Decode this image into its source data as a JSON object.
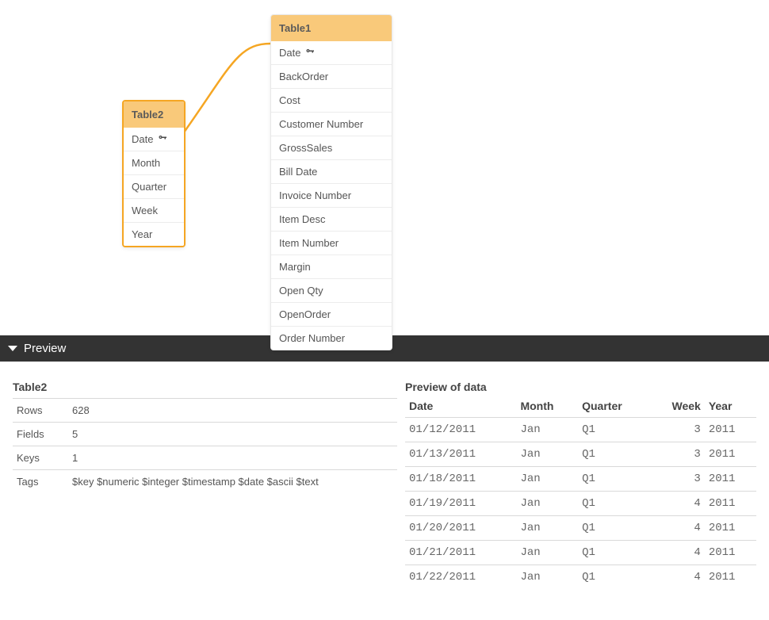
{
  "diagram": {
    "table1": {
      "title": "Table1",
      "fields": [
        {
          "name": "Date",
          "isKey": true
        },
        {
          "name": "BackOrder",
          "isKey": false
        },
        {
          "name": "Cost",
          "isKey": false
        },
        {
          "name": "Customer Number",
          "isKey": false
        },
        {
          "name": "GrossSales",
          "isKey": false
        },
        {
          "name": "Bill Date",
          "isKey": false
        },
        {
          "name": "Invoice Number",
          "isKey": false
        },
        {
          "name": "Item Desc",
          "isKey": false
        },
        {
          "name": "Item Number",
          "isKey": false
        },
        {
          "name": "Margin",
          "isKey": false
        },
        {
          "name": "Open Qty",
          "isKey": false
        },
        {
          "name": "OpenOrder",
          "isKey": false
        },
        {
          "name": "Order Number",
          "isKey": false
        }
      ]
    },
    "table2": {
      "title": "Table2",
      "fields": [
        {
          "name": "Date",
          "isKey": true
        },
        {
          "name": "Month",
          "isKey": false
        },
        {
          "name": "Quarter",
          "isKey": false
        },
        {
          "name": "Week",
          "isKey": false
        },
        {
          "name": "Year",
          "isKey": false
        }
      ]
    }
  },
  "preview": {
    "title": "Preview",
    "left": {
      "table_name": "Table2",
      "rows_label": "Rows",
      "rows_value": "628",
      "fields_label": "Fields",
      "fields_value": "5",
      "keys_label": "Keys",
      "keys_value": "1",
      "tags_label": "Tags",
      "tags_value": "$key $numeric $integer $timestamp $date $ascii $text"
    },
    "right": {
      "title": "Preview of data",
      "columns": [
        "Date",
        "Month",
        "Quarter",
        "Week",
        "Year"
      ],
      "rows": [
        [
          "01/12/2011",
          "Jan",
          "Q1",
          "3",
          "2011"
        ],
        [
          "01/13/2011",
          "Jan",
          "Q1",
          "3",
          "2011"
        ],
        [
          "01/18/2011",
          "Jan",
          "Q1",
          "3",
          "2011"
        ],
        [
          "01/19/2011",
          "Jan",
          "Q1",
          "4",
          "2011"
        ],
        [
          "01/20/2011",
          "Jan",
          "Q1",
          "4",
          "2011"
        ],
        [
          "01/21/2011",
          "Jan",
          "Q1",
          "4",
          "2011"
        ],
        [
          "01/22/2011",
          "Jan",
          "Q1",
          "4",
          "2011"
        ]
      ]
    }
  }
}
